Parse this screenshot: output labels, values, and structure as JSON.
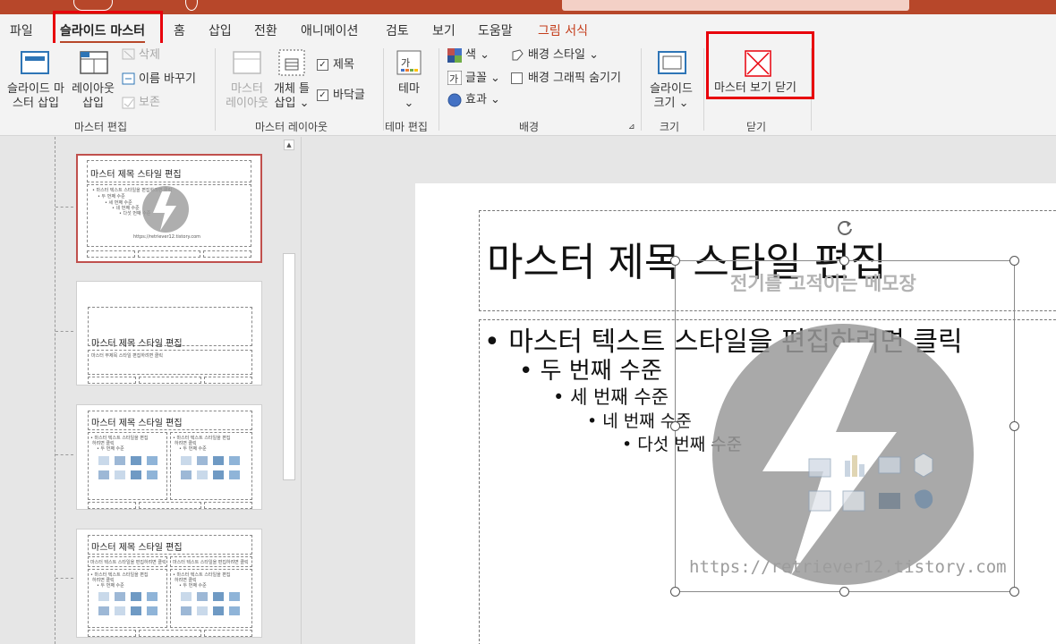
{
  "tabs": {
    "file": "파일",
    "slide_master": "슬라이드 마스터",
    "home": "홈",
    "insert": "삽입",
    "transitions": "전환",
    "animations": "애니메이션",
    "review": "검토",
    "view": "보기",
    "help": "도움말",
    "picture_format": "그림 서식"
  },
  "ribbon": {
    "master_edit": {
      "insert_slide_master": [
        "슬라이드 마",
        "스터 삽입"
      ],
      "insert_layout": [
        "레이아웃",
        "삽입"
      ],
      "delete": "삭제",
      "rename": "이름 바꾸기",
      "preserve": "보존",
      "label": "마스터 편집"
    },
    "master_layout": {
      "master_layout_btn": [
        "마스터",
        "레이아웃"
      ],
      "insert_placeholder": [
        "개체 틀",
        "삽입"
      ],
      "title": "제목",
      "footers": "바닥글",
      "label": "마스터 레이아웃"
    },
    "edit_theme": {
      "themes": "테마",
      "label": "테마 편집"
    },
    "background": {
      "colors": "색",
      "fonts": "글꼴",
      "effects": "효과",
      "background_styles": "배경 스타일",
      "hide_background_graphics": "배경 그래픽 숨기기",
      "label": "배경"
    },
    "size": {
      "slide_size": [
        "슬라이드",
        "크기"
      ],
      "label": "크기"
    },
    "close": {
      "close_master_view": "마스터 보기 닫기",
      "label": "닫기"
    }
  },
  "thumbnails": {
    "t1": {
      "title": "마스터 제목 스타일 편집",
      "body": [
        "• 마스터 텍스트 스타일을 편집하려면 클릭",
        "• 두 번째 수준",
        "• 세 번째 수준",
        "• 네 번째 수준",
        "• 다섯 번째 수준"
      ],
      "watermark": "https://retriever12.tistory.com"
    },
    "t2": {
      "title": "마스터 제목 스타일 편집",
      "sub": "마스터 부제목 스타일 편집하려면 클릭"
    },
    "t3": {
      "title": "마스터 제목 스타일 편집",
      "body": [
        "• 마스터 텍스트 스타일을 편집",
        "하려면 클릭",
        "• 두 번째 수준"
      ]
    },
    "t4": {
      "title": "마스터 제목 스타일 편집",
      "body": [
        "마스터 텍스트 스타일을 편집하려면 클릭",
        "• 마스터 텍스트 스타일을 편집",
        "하려면 클릭",
        "• 두 번째 수준"
      ]
    }
  },
  "slide": {
    "title": "마스터 제목 스타일 편집",
    "levels": [
      "마스터 텍스트 스타일을 편집하려면 클릭",
      "두 번째 수준",
      "세 번째 수준",
      "네 번째 수준",
      "다섯 번째 수준"
    ],
    "picture_caption": "전기를 고적이는 메모장",
    "picture_url": "https://retriever12.tistory.com"
  },
  "colors": {
    "accent": "#b7472a",
    "annotation": "#e8000b",
    "logo_gray": "#9a9a9a"
  }
}
